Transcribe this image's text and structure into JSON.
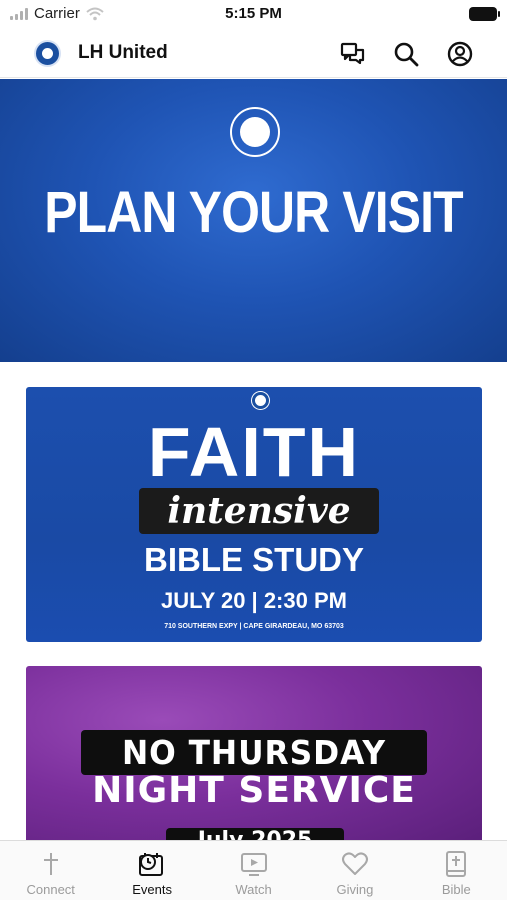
{
  "status_bar": {
    "carrier": "Carrier",
    "time": "5:15 PM"
  },
  "header": {
    "title": "LH United",
    "icons": [
      "chat-icon",
      "search-icon",
      "account-icon"
    ]
  },
  "content": {
    "hero": {
      "title": "PLAN YOUR VISIT"
    },
    "events": [
      {
        "line1": "FAITH",
        "line2": "intensive",
        "line3": "BIBLE STUDY",
        "line4": "JULY 20 | 2:30 PM",
        "address": "710 SOUTHERN EXPY | CAPE GIRARDEAU, MO 63703"
      },
      {
        "line1": "NO THURSDAY",
        "line2": "NIGHT SERVICE",
        "line3": "July 2025"
      }
    ]
  },
  "tabbar": {
    "tabs": [
      {
        "label": "Connect",
        "icon": "cross-icon",
        "active": false
      },
      {
        "label": "Events",
        "icon": "calendar-clock-icon",
        "active": true
      },
      {
        "label": "Watch",
        "icon": "play-screen-icon",
        "active": false
      },
      {
        "label": "Giving",
        "icon": "heart-icon",
        "active": false
      },
      {
        "label": "Bible",
        "icon": "bible-icon",
        "active": false
      }
    ]
  },
  "colors": {
    "brand_blue": "#1a4fa0",
    "tab_active": "#111111",
    "tab_inactive": "#9b9b9b",
    "event2_purple": "#7b2f9c"
  }
}
